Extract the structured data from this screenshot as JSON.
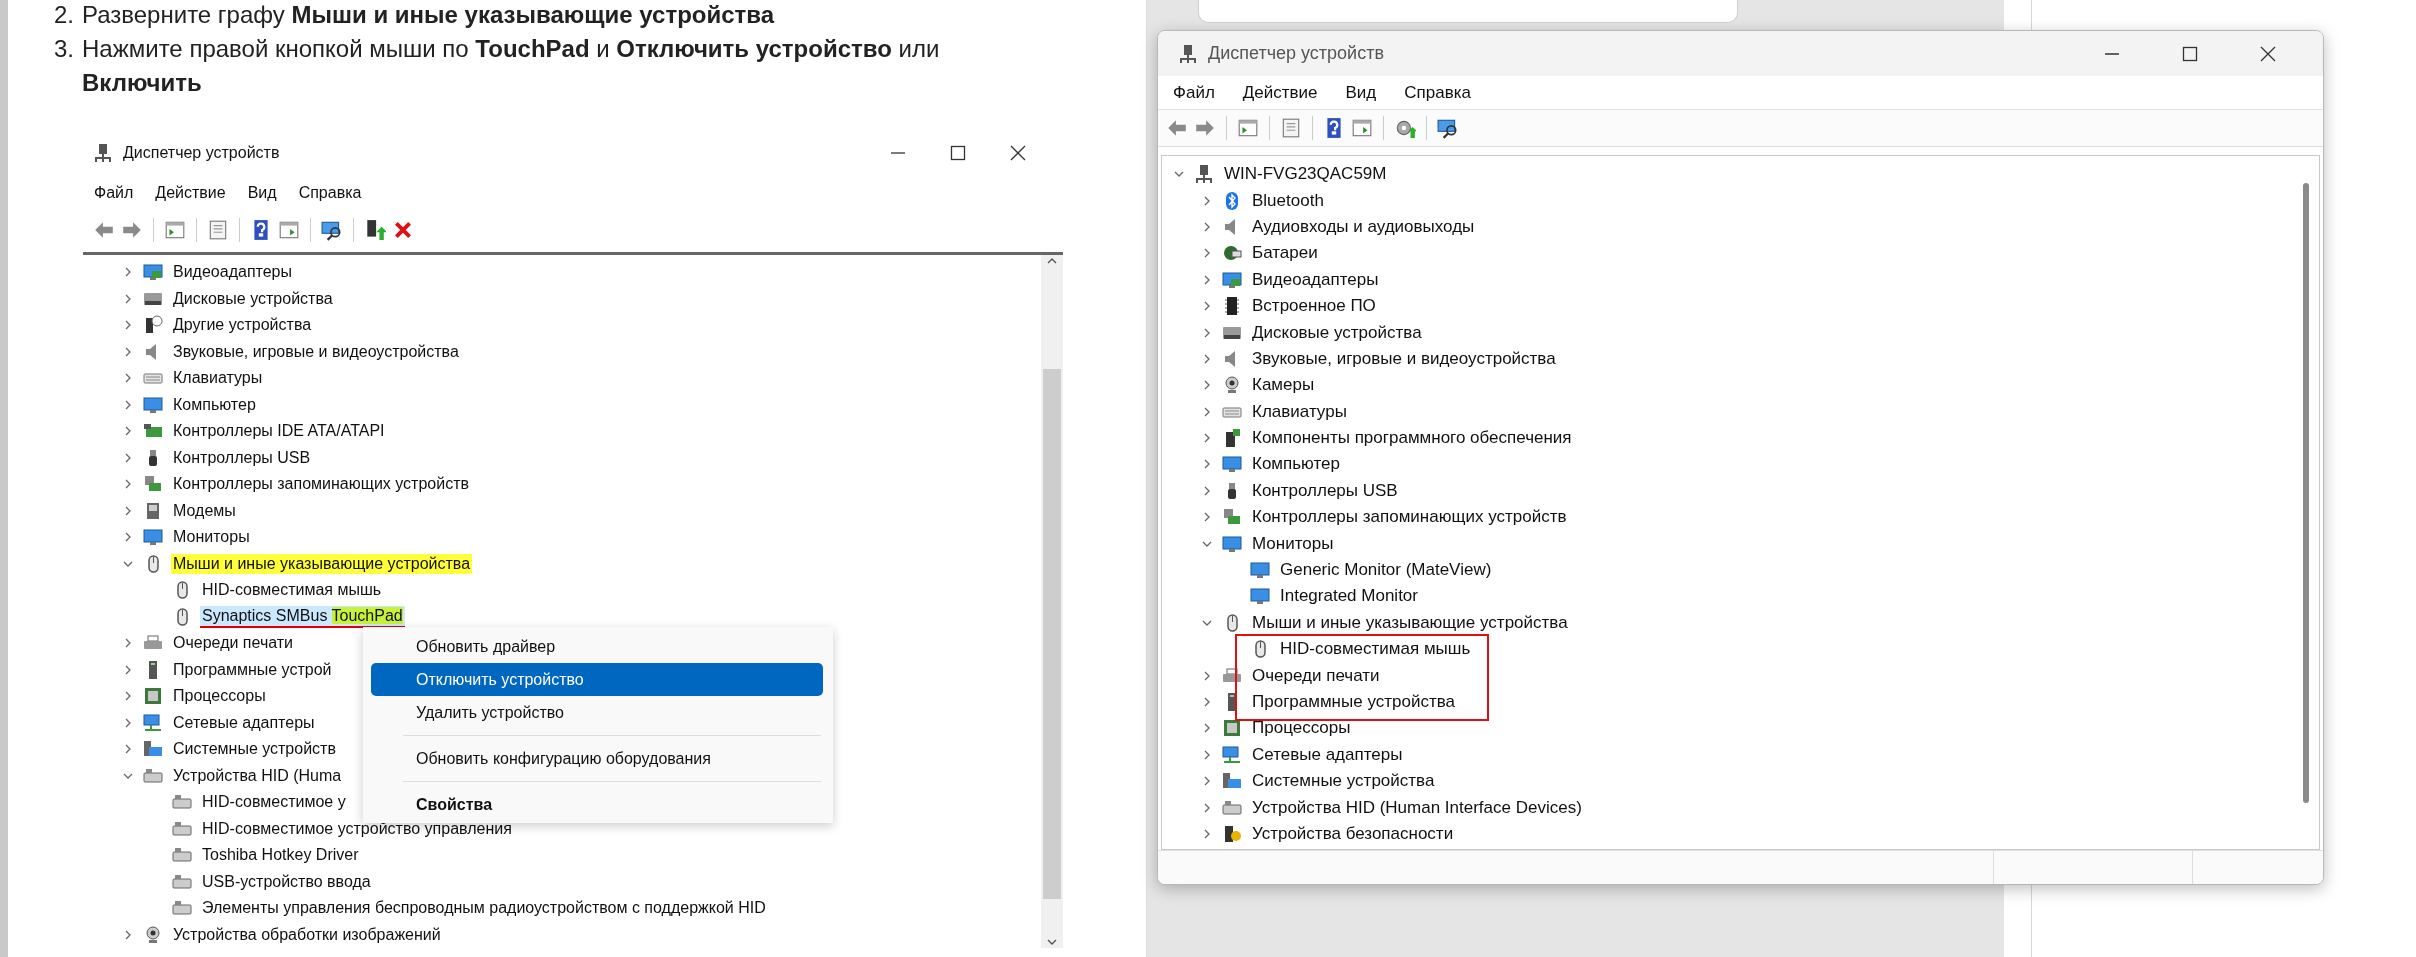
{
  "article": {
    "steps": [
      {
        "number": "2.",
        "text": "Разверните графу **Мыши и иные указывающие устройства**"
      },
      {
        "number": "3.",
        "text": "Нажмите правой кнопкой мыши по **TouchPad** и **Отключить устройство** или **Включить**"
      }
    ],
    "screenshot": {
      "title": "Диспетчер устройств",
      "menu": [
        "Файл",
        "Действие",
        "Вид",
        "Справка"
      ],
      "tree": [
        {
          "label": "Видеоадаптеры",
          "expanded": false,
          "selected": false,
          "highlighted": false
        },
        {
          "label": "Дисковые устройства",
          "expanded": false,
          "selected": false,
          "highlighted": false
        },
        {
          "label": "Другие устройства",
          "expanded": false,
          "selected": false,
          "highlighted": false
        },
        {
          "label": "Звуковые, игровые и видеоустройства",
          "expanded": false,
          "selected": false,
          "highlighted": false
        },
        {
          "label": "Клавиатуры",
          "expanded": false,
          "selected": false,
          "highlighted": false
        },
        {
          "label": "Компьютер",
          "expanded": false,
          "selected": false,
          "highlighted": false
        },
        {
          "label": "Контроллеры IDE ATA/ATAPI",
          "expanded": false,
          "selected": false,
          "highlighted": false
        },
        {
          "label": "Контроллеры USB",
          "expanded": false,
          "selected": false,
          "highlighted": false
        },
        {
          "label": "Контроллеры запоминающих устройств",
          "expanded": false,
          "selected": false,
          "highlighted": false
        },
        {
          "label": "Модемы",
          "expanded": false,
          "selected": false,
          "highlighted": false
        },
        {
          "label": "Мониторы",
          "expanded": false,
          "selected": false,
          "highlighted": false
        },
        {
          "label": "Мыши и иные указывающие устройства",
          "expanded": true,
          "selected": false,
          "highlighted": true,
          "children": [
            {
              "label": "HID-совместимая мышь",
              "selected": false,
              "highlighted": false
            },
            {
              "parts": [
                {
                  "text": "Synaptics SMBus ",
                  "highlighted": false
                },
                {
                  "text": "TouchPad",
                  "highlighted": true
                }
              ],
              "selected": true,
              "underlined": true
            }
          ]
        },
        {
          "label": "Очереди печати",
          "expanded": false,
          "selected": false,
          "highlighted": false
        },
        {
          "label": "Программные устрой",
          "expanded": false,
          "selected": false,
          "highlighted": false
        },
        {
          "label": "Процессоры",
          "expanded": false,
          "selected": false,
          "highlighted": false
        },
        {
          "label": "Сетевые адаптеры",
          "expanded": false,
          "selected": false,
          "highlighted": false
        },
        {
          "label": "Системные устройств",
          "expanded": false,
          "selected": false,
          "highlighted": false
        },
        {
          "label": "Устройства HID (Huma",
          "expanded": true,
          "selected": false,
          "highlighted": false,
          "children": [
            {
              "label": "HID-совместимое у",
              "selected": false,
              "highlighted": false
            },
            {
              "label": "HID-совместимое устройство управления",
              "selected": false,
              "highlighted": false
            },
            {
              "label": "Toshiba Hotkey Driver",
              "selected": false,
              "highlighted": false
            },
            {
              "label": "USB-устройство ввода",
              "selected": false,
              "highlighted": false
            },
            {
              "label": "Элементы управления беспроводным радиоустройством с поддержкой HID",
              "selected": false,
              "highlighted": false
            }
          ]
        },
        {
          "label": "Устройства обработки изображений",
          "expanded": false,
          "selected": false,
          "highlighted": false
        }
      ],
      "context_menu": [
        {
          "kind": "item",
          "label": "Обновить драйвер",
          "selected": false
        },
        {
          "kind": "item",
          "label": "Отключить устройство",
          "selected": true
        },
        {
          "kind": "item",
          "label": "Удалить устройство",
          "selected": false
        },
        {
          "kind": "separator"
        },
        {
          "kind": "item",
          "label": "Обновить конфигурацию оборудования",
          "selected": false
        },
        {
          "kind": "separator"
        },
        {
          "kind": "default",
          "label": "Свойства",
          "selected": false
        }
      ]
    }
  },
  "device_window": {
    "title": "Диспетчер устройств",
    "menu": [
      "Файл",
      "Действие",
      "Вид",
      "Справка"
    ],
    "tree": [
      {
        "label": "WIN-FVG23QAC59M",
        "expanded": true,
        "children": [
          {
            "label": "Bluetooth",
            "expanded": false
          },
          {
            "label": "Аудиовходы и аудиовыходы",
            "expanded": false
          },
          {
            "label": "Батареи",
            "expanded": false
          },
          {
            "label": "Видеоадаптеры",
            "expanded": false
          },
          {
            "label": "Встроенное ПО",
            "expanded": false
          },
          {
            "label": "Дисковые устройства",
            "expanded": false
          },
          {
            "label": "Звуковые, игровые и видеоустройства",
            "expanded": false
          },
          {
            "label": "Камеры",
            "expanded": false
          },
          {
            "label": "Клавиатуры",
            "expanded": false
          },
          {
            "label": "Компоненты программного обеспечения",
            "expanded": false
          },
          {
            "label": "Компьютер",
            "expanded": false
          },
          {
            "label": "Контроллеры USB",
            "expanded": false
          },
          {
            "label": "Контроллеры запоминающих устройств",
            "expanded": false
          },
          {
            "label": "Мониторы",
            "expanded": true,
            "children": [
              {
                "label": "Generic Monitor (MateView)"
              },
              {
                "label": "Integrated Monitor"
              }
            ]
          },
          {
            "label": "Мыши и иные указывающие устройства",
            "expanded": true,
            "children": [
              {
                "label": "HID-совместимая мышь"
              }
            ]
          },
          {
            "label": "Очереди печати",
            "expanded": false
          },
          {
            "label": "Программные устройства",
            "expanded": false
          },
          {
            "label": "Процессоры",
            "expanded": false
          },
          {
            "label": "Сетевые адаптеры",
            "expanded": false
          },
          {
            "label": "Системные устройства",
            "expanded": false
          },
          {
            "label": "Устройства HID (Human Interface Devices)",
            "expanded": false
          },
          {
            "label": "Устройства безопасности",
            "expanded": false
          }
        ]
      }
    ]
  }
}
